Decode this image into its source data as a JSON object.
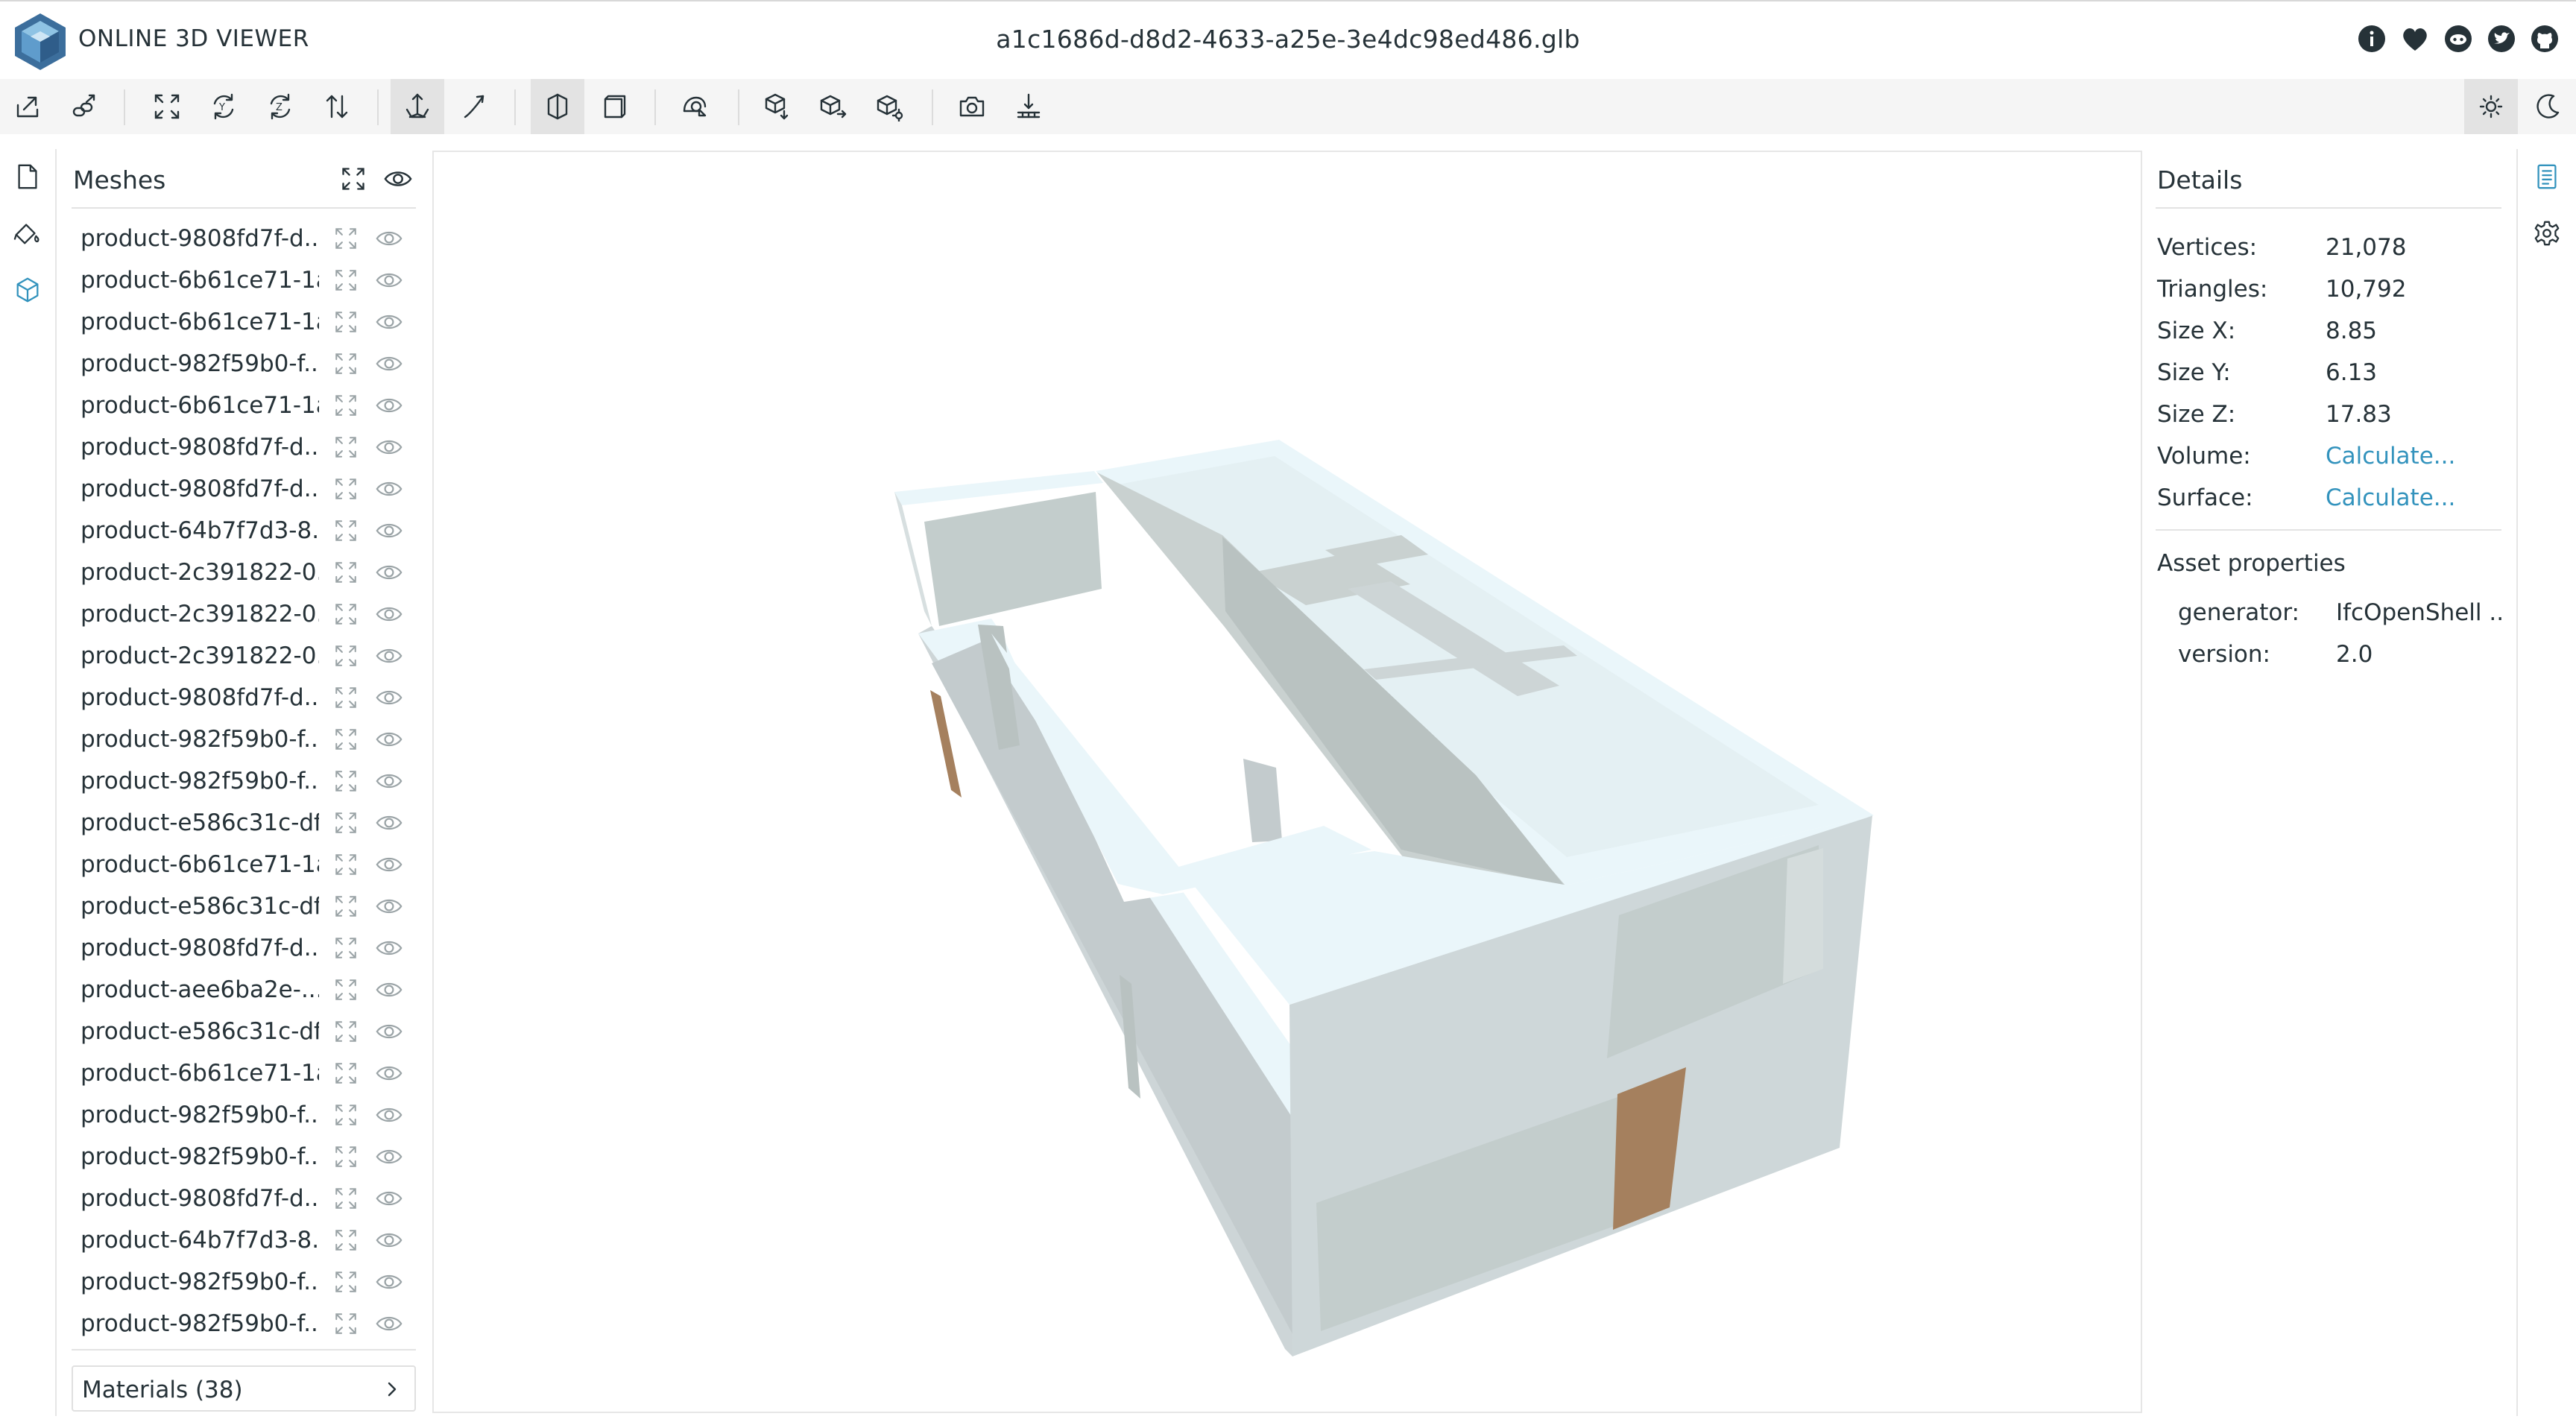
{
  "app": {
    "title": "ONLINE 3D VIEWER",
    "file_name": "a1c1686d-d8d2-4633-a25e-3e4dc98ed486.glb"
  },
  "header_icons": [
    "info-icon",
    "heart-icon",
    "discord-icon",
    "twitter-icon",
    "github-icon"
  ],
  "toolbar": {
    "buttons": [
      {
        "name": "open-file-icon"
      },
      {
        "name": "open-url-icon"
      },
      {
        "name": "fit-to-window-icon"
      },
      {
        "name": "set-up-vector-icon"
      },
      {
        "name": "set-up-vector-z-icon"
      },
      {
        "name": "flip-up-vector-icon"
      },
      {
        "name": "fixed-up-vector-icon",
        "active": true
      },
      {
        "name": "free-orbit-icon"
      },
      {
        "name": "perspective-camera-icon",
        "active": true
      },
      {
        "name": "orthographic-camera-icon"
      },
      {
        "name": "edges-icon"
      },
      {
        "name": "export-model-icon"
      },
      {
        "name": "share-model-icon"
      },
      {
        "name": "snapshot-icon"
      },
      {
        "name": "camera-export-icon"
      },
      {
        "name": "measure-icon"
      },
      {
        "name": "light-theme-icon",
        "active": true
      },
      {
        "name": "dark-theme-icon"
      }
    ]
  },
  "left_panel_icons": [
    "file-details-icon",
    "materials-icon",
    "meshes-icon"
  ],
  "meshes": {
    "title": "Meshes",
    "items": [
      "product-9808fd7f-d...",
      "product-6b61ce71-1a...",
      "product-6b61ce71-1a...",
      "product-982f59b0-f...",
      "product-6b61ce71-1a...",
      "product-9808fd7f-d...",
      "product-9808fd7f-d...",
      "product-64b7f7d3-8...",
      "product-2c391822-0...",
      "product-2c391822-0...",
      "product-2c391822-0...",
      "product-9808fd7f-d...",
      "product-982f59b0-f...",
      "product-982f59b0-f...",
      "product-e586c31c-df...",
      "product-6b61ce71-1a...",
      "product-e586c31c-df...",
      "product-9808fd7f-d...",
      "product-aee6ba2e-...",
      "product-e586c31c-df...",
      "product-6b61ce71-1a...",
      "product-982f59b0-f...",
      "product-982f59b0-f...",
      "product-9808fd7f-d...",
      "product-64b7f7d3-8...",
      "product-982f59b0-f...",
      "product-982f59b0-f..."
    ],
    "materials_label": "Materials (38)"
  },
  "details": {
    "title": "Details",
    "properties": [
      {
        "label": "Vertices:",
        "value": "21,078"
      },
      {
        "label": "Triangles:",
        "value": "10,792"
      },
      {
        "label": "Size X:",
        "value": "8.85"
      },
      {
        "label": "Size Y:",
        "value": "6.13"
      },
      {
        "label": "Size Z:",
        "value": "17.83"
      },
      {
        "label": "Volume:",
        "value": "Calculate...",
        "link": true
      },
      {
        "label": "Surface:",
        "value": "Calculate...",
        "link": true
      }
    ],
    "asset_title": "Asset properties",
    "asset_properties": [
      {
        "label": "generator:",
        "value": "IfcOpenShell ..."
      },
      {
        "label": "version:",
        "value": "2.0"
      }
    ]
  },
  "right_panel_icons": [
    "details-panel-icon",
    "settings-icon"
  ],
  "colors": {
    "text": "#263238",
    "link": "#3393bd",
    "icon": "#263238",
    "toolbar_bg": "#f5f5f5",
    "active_bg": "#e3e3e3",
    "accent_icon": "#3393bd",
    "model_wall_light": "#eaf6fa",
    "model_wall_mid": "#cdd5d7",
    "model_wall_dark": "#b9c2c1",
    "model_door": "#a5805e"
  }
}
